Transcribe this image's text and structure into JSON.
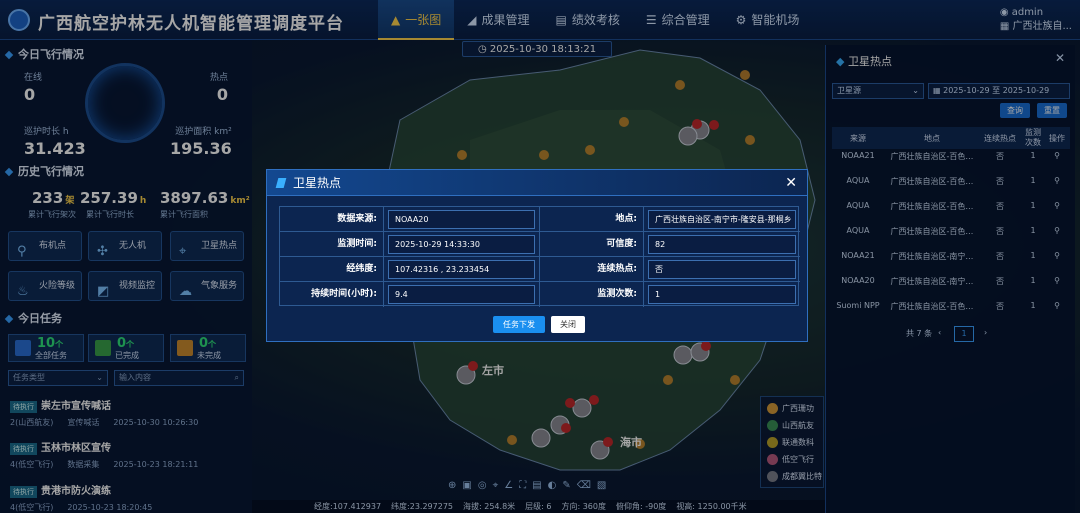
{
  "header": {
    "title": "广西航空护林无人机智能管理调度平台",
    "nav": [
      {
        "label": "一张图",
        "icon": "warning-triangle-icon",
        "active": true
      },
      {
        "label": "成果管理",
        "icon": "send-icon"
      },
      {
        "label": "绩效考核",
        "icon": "doc-icon"
      },
      {
        "label": "综合管理",
        "icon": "layers-icon"
      },
      {
        "label": "智能机场",
        "icon": "gear-icon"
      }
    ],
    "user": "admin",
    "org": "广西壮族自..."
  },
  "datetime": "2025-10-30 18:13:21",
  "today": {
    "title": "今日飞行情况",
    "online_label": "在线",
    "online": "0",
    "hotspot_label": "热点",
    "hotspot": "0",
    "duration_label": "巡护时长 h",
    "duration": "31.423",
    "area_label": "巡护面积 km²",
    "area": "195.36"
  },
  "history": {
    "title": "历史飞行情况",
    "sorties": "233",
    "sorties_unit": "架",
    "hours": "257.39",
    "hours_unit": "h",
    "area": "3897.63",
    "area_unit": "km²",
    "sorties_label": "累计飞行架次",
    "hours_label": "累计飞行时长",
    "area_label": "累计飞行面积"
  },
  "buttons": [
    {
      "label": "布机点",
      "icon": "pin-icon"
    },
    {
      "label": "无人机",
      "icon": "drone-icon"
    },
    {
      "label": "卫星热点",
      "icon": "satellite-icon"
    },
    {
      "label": "火险等级",
      "icon": "fire-icon"
    },
    {
      "label": "视频监控",
      "icon": "camera-icon"
    },
    {
      "label": "气象服务",
      "icon": "cloud-icon"
    }
  ],
  "tasks": {
    "title": "今日任务",
    "all": "10",
    "all_unit": "个",
    "all_label": "全部任务",
    "done": "0",
    "done_unit": "个",
    "done_label": "已完成",
    "undone": "0",
    "undone_unit": "个",
    "undone_label": "未完成",
    "type_placeholder": "任务类型",
    "search_placeholder": "输入内容",
    "list": [
      {
        "tag": "待执行",
        "title": "崇左市宣传喊话",
        "team": "2(山西航友)",
        "kind": "宣传喊话",
        "time": "2025-10-30 10:26:30"
      },
      {
        "tag": "待执行",
        "title": "玉林市林区宣传",
        "team": "4(低空飞行)",
        "kind": "数据采集",
        "time": "2025-10-23 18:21:11"
      },
      {
        "tag": "待执行",
        "title": "贵港市防火演练",
        "team": "4(低空飞行)",
        "kind": "",
        "time": "2025-10-23 18:20:45"
      }
    ]
  },
  "right": {
    "title": "卫星热点",
    "source_select": "卫星源",
    "date_from": "2025-10-29",
    "date_to_sep": "至",
    "date_to": "2025-10-29",
    "query": "查询",
    "reset": "重置",
    "columns": [
      "来源",
      "地点",
      "连续热点",
      "监测次数",
      "操作"
    ],
    "rows": [
      {
        "source": "NOAA21",
        "place": "广西壮族自治区-百色…",
        "cont": "否",
        "count": "1"
      },
      {
        "source": "AQUA",
        "place": "广西壮族自治区-百色…",
        "cont": "否",
        "count": "1"
      },
      {
        "source": "AQUA",
        "place": "广西壮族自治区-百色…",
        "cont": "否",
        "count": "1"
      },
      {
        "source": "AQUA",
        "place": "广西壮族自治区-百色…",
        "cont": "否",
        "count": "1"
      },
      {
        "source": "NOAA21",
        "place": "广西壮族自治区-南宁…",
        "cont": "否",
        "count": "1"
      },
      {
        "source": "NOAA20",
        "place": "广西壮族自治区-南宁…",
        "cont": "否",
        "count": "1"
      },
      {
        "source": "Suomi NPP",
        "place": "广西壮族自治区-百色…",
        "cont": "否",
        "count": "1"
      }
    ],
    "total": "共 7 条",
    "page": "1"
  },
  "legend": [
    {
      "label": "广西珊功",
      "color": "#d49a3a",
      "n": "1"
    },
    {
      "label": "山西航友",
      "color": "#3a8f56",
      "n": "2"
    },
    {
      "label": "联通数科",
      "color": "#b9a22a",
      "n": "3"
    },
    {
      "label": "低空飞行",
      "color": "#b65a7e",
      "n": "4"
    },
    {
      "label": "成都翼比特",
      "color": "#7c7f8a",
      "n": "5"
    }
  ],
  "map_labels": [
    {
      "text": "左市"
    },
    {
      "text": "海市"
    }
  ],
  "status": {
    "lng": "经度:107.412937",
    "lat": "纬度:23.297275",
    "alt": "海拔: 254.8米",
    "level": "层级: 6",
    "heading": "方向: 360度",
    "pitch": "俯仰角: -90度",
    "view": "视高: 1250.00千米"
  },
  "modal": {
    "title": "卫星热点",
    "source_label": "数据来源:",
    "source": "NOAA20",
    "place_label": "地点:",
    "place": "广西壮族自治区-南宁市-隆安县-那桐乡",
    "time_label": "监测时间:",
    "time": "2025-10-29 14:33:30",
    "conf_label": "可信度:",
    "conf": "82",
    "coord_label": "经纬度:",
    "coord": "107.42316 , 23.233454",
    "cont_label": "连续热点:",
    "cont": "否",
    "dur_label": "持续时间(小时):",
    "dur": "9.4",
    "count_label": "监测次数:",
    "count": "1",
    "dispatch": "任务下发",
    "close": "关闭"
  }
}
